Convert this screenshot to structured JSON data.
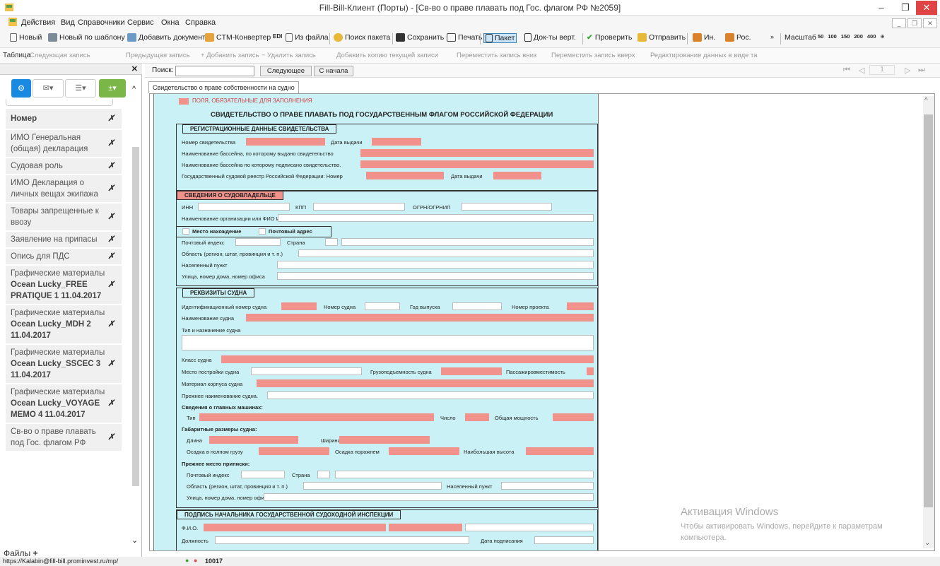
{
  "window": {
    "title": "Fill-Bill-Клиент (Порты) - [Св-во о праве плавать под Гос. флагом РФ №2059]"
  },
  "menu": [
    "Действия",
    "Вид",
    "Справочники",
    "Сервис",
    "Окна",
    "Справка"
  ],
  "toolbar": {
    "new": "Новый",
    "new_tpl": "Новый по шаблону",
    "add_doc": "Добавить документ",
    "ctm": "CTM-Конвертер",
    "from_file": "Из файла",
    "find_pkg": "Поиск пакета",
    "save": "Сохранить",
    "print": "Печать",
    "packet": "Пакет",
    "docs_vert": "Док-ты верт.",
    "check": "Проверить",
    "send": "Отправить",
    "in": "Ин.",
    "ros": "Рос.",
    "scale": "Масштаб",
    "scales": [
      "50",
      "100",
      "150",
      "200",
      "400"
    ]
  },
  "table_toolbar": {
    "label": "Таблица",
    "items": [
      "Следующая запись",
      "Предыдущая запись",
      "+ Добавить запись",
      "− Удалить запись",
      "Добавить копию текущей записи",
      "Переместить запись вниз",
      "Переместить запись вверх",
      "Редактирование данных в виде та"
    ]
  },
  "sidebar": {
    "header": "Номер",
    "items": [
      {
        "label": "ИМО Генеральная (общая) декларация"
      },
      {
        "label": "Судовая роль"
      },
      {
        "label": "ИМО Декларация о личных вещах экипажа"
      },
      {
        "label": "Товары запрещенные к ввозу"
      },
      {
        "label": "Заявление на припасы"
      },
      {
        "label": "Опись для ПДС"
      },
      {
        "pre": "Графические материалы ",
        "bold": "Ocean Lucky_FREE PRATIQUE 1 11.04.2017"
      },
      {
        "pre": "Графические материалы ",
        "bold": "Ocean Lucky_MDH 2 11.04.2017"
      },
      {
        "pre": "Графические материалы ",
        "bold": "Ocean Lucky_SSCEC 3 11.04.2017"
      },
      {
        "pre": "Графические материалы ",
        "bold": "Ocean Lucky_VOYAGE MEMO 4 11.04.2017"
      },
      {
        "label": "Св-во о праве плавать под Гос. флагом РФ"
      }
    ],
    "files": "Файлы"
  },
  "search": {
    "label": "Поиск:",
    "next": "Следующее",
    "from_start": "С начала",
    "page": "1"
  },
  "tab": "Свидетельство о праве собственности на судно",
  "form": {
    "legend": "ПОЛЯ, ОБЯЗАТЕЛЬНЫЕ ДЛЯ ЗАПОЛНЕНИЯ",
    "title": "СВИДЕТЕЛЬСТВО О ПРАВЕ ПЛАВАТЬ ПОД ГОСУДАРСТВЕННЫМ ФЛАГОМ РОССИЙСКОЙ ФЕДЕРАЦИИ",
    "s1": "РЕГИСТРАЦИОННЫЕ ДАННЫЕ СВИДЕТЕЛЬСТВА",
    "cert_no": "Номер свидетельства",
    "issue_date": "Дата выдачи",
    "basin_issued": "Наименование бассейна, по которому выдано свидетельство",
    "basin_signed": "Наименование бассейна по которому подписано свидетельство.",
    "registry": "Государственный судовой реестр Российской Федерации: Номер",
    "s2": "СВЕДЕНИЯ О СУДОВЛАДЕЛЬЦЕ",
    "inn": "ИНН",
    "kpp": "КПП",
    "ogrn": "ОГРН/ОГРНИП",
    "org": "Наименование организации или ФИО ИП",
    "location": "Место нахождение",
    "postal_addr": "Почтовый адрес",
    "zip": "Почтовый индекс",
    "country": "Страна",
    "region": "Область (регион, штат, провинция и т. п.)",
    "city": "Населенный пункт",
    "street": "Улица, номер дома, номер офиса",
    "s3": "РЕКВИЗИТЫ СУДНА",
    "imo": "Идентификационный номер судна",
    "ship_no": "Номер судна",
    "year": "Год выпуска",
    "project": "Номер проекта",
    "ship_name": "Наименование судна",
    "type_purpose": "Тип и назначение судна",
    "class": "Класс судна",
    "build_place": "Место постройки судна",
    "capacity": "Грузоподъемность судна",
    "pass": "Пассажировместимость",
    "hull": "Материал корпуса судна",
    "prev_name": "Прежнее наименование судна.",
    "engines": "Сведения о главных машинах:",
    "type": "Тип",
    "count": "Число",
    "power": "Общая мощность",
    "dims": "Габаритные размеры судна:",
    "length": "Длина",
    "width": "Ширина",
    "draft_full": "Осадка в полном грузу",
    "draft_empty": "Осадка порожнем",
    "max_height": "Наибольшая высота",
    "prev_port": "Прежнее место приписки:",
    "s4": "ПОДПИСЬ НАЧАЛЬНИКА ГОСУДАРСТВЕННОЙ СУДОХОДНОЙ ИНСПЕКЦИИ",
    "fio": "Ф.И.О.",
    "position": "Должность",
    "sign_date": "Дата подписания"
  },
  "watermark": {
    "title": "Активация Windows",
    "text": "Чтобы активировать Windows, перейдите к параметрам компьютера."
  },
  "status": {
    "url": "https://Kalabin@fill-bill.prominvest.ru/mp/",
    "count": "10017"
  },
  "colors": {
    "form_bg": "#caf2f6",
    "required": "#f1928d",
    "accent_green": "#7ab648",
    "accent_blue": "#1a8ae0"
  }
}
